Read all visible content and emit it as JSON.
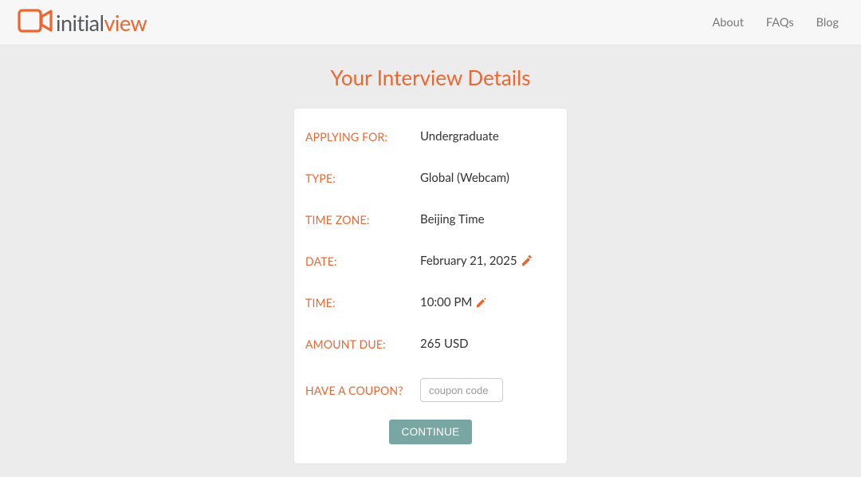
{
  "brand": {
    "name_part1": "initial",
    "name_part2": "view"
  },
  "nav": {
    "about": "About",
    "faqs": "FAQs",
    "blog": "Blog"
  },
  "page": {
    "title": "Your Interview Details"
  },
  "details": {
    "applying_for": {
      "label": "APPLYING FOR:",
      "value": "Undergraduate"
    },
    "type": {
      "label": "TYPE:",
      "value": "Global (Webcam)"
    },
    "time_zone": {
      "label": "TIME ZONE:",
      "value": "Beijing Time"
    },
    "date": {
      "label": "DATE:",
      "value": "February 21, 2025"
    },
    "time": {
      "label": "TIME:",
      "value": "10:00 PM"
    },
    "amount_due": {
      "label": "AMOUNT DUE:",
      "value": "265 USD"
    },
    "coupon": {
      "label": "HAVE A COUPON?",
      "placeholder": "coupon code",
      "value": ""
    }
  },
  "actions": {
    "continue": "CONTINUE"
  },
  "colors": {
    "accent": "#ec6730",
    "button": "#79a6a3"
  }
}
